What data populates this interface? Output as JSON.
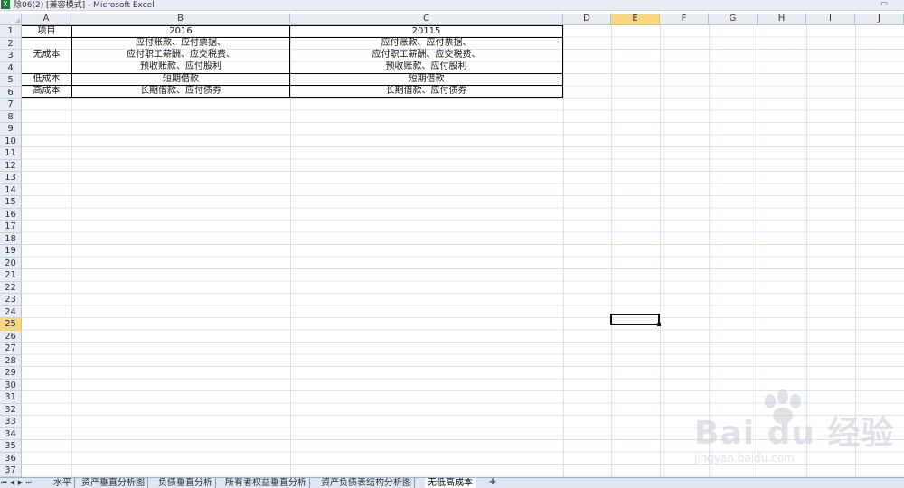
{
  "window": {
    "title": "除06(2)  [兼容模式] - Microsoft Excel",
    "icon_label": "X"
  },
  "column_headers": [
    "A",
    "B",
    "C",
    "D",
    "E",
    "F",
    "G",
    "H",
    "I",
    "J"
  ],
  "row_headers": [
    "1",
    "2",
    "3",
    "4",
    "5",
    "6",
    "7",
    "8",
    "9",
    "10",
    "11",
    "12",
    "13",
    "14",
    "15",
    "16",
    "17",
    "18",
    "19",
    "20",
    "21",
    "22",
    "23",
    "24",
    "25",
    "26",
    "27",
    "28",
    "29",
    "30",
    "31",
    "32",
    "33",
    "34",
    "35",
    "36",
    "37"
  ],
  "active_cell": {
    "column": "E",
    "row": "25"
  },
  "table": {
    "header": {
      "item": "项目",
      "year1": "2016",
      "year2": "20115"
    },
    "no_cost": {
      "label": "无成本",
      "line1": "应付账款、应付票据、",
      "line2": "应付职工薪酬、应交税费、",
      "line3": "预收账款、应付股利"
    },
    "low_cost": {
      "label": "低成本",
      "value": "短期借款"
    },
    "high_cost": {
      "label": "高成本",
      "value": "长期借款、应付债券"
    }
  },
  "sheet_tabs": [
    "水平",
    "资产垂直分析图",
    "负债垂直分析",
    "所有者权益垂直分析",
    "资产负债表结构分析图",
    "无低高成本"
  ],
  "active_sheet": "无低高成本",
  "watermark": {
    "brand": "Bai du 经验",
    "url": "jingyan.baidu.com"
  }
}
